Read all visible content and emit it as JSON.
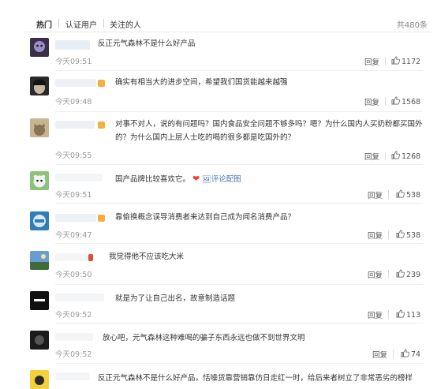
{
  "tabs": [
    {
      "label": "热门",
      "active": true
    },
    {
      "label": "认证用户",
      "active": false
    },
    {
      "label": "关注的人",
      "active": false
    }
  ],
  "total_label": "共480条",
  "comments": [
    {
      "text": "反正元气森林不是什么好产品",
      "time": "今天09:51",
      "reply": "回复",
      "likes": "1172"
    },
    {
      "text": "确实有相当大的进步空间，希望我们国货能越来越强",
      "time": "今天09:48",
      "reply": "回复",
      "likes": "1568"
    },
    {
      "text": "对事不对人，说的有问题吗？国内食品安全问题不够多吗？嗯？为什么国内人买奶粉都买国外的？为什么国内上层人士吃的喝的很多都是吃国外的？",
      "time": "今天09:55",
      "reply": "回复",
      "likes": "1268"
    },
    {
      "text": "国产品牌比较喜欢它。",
      "emoji": "❤",
      "link": "评论配图",
      "time": "今天09:51",
      "reply": "回复",
      "likes": "538"
    },
    {
      "text": "靠偷换概念误导消费者来达到自己成为闻名消费产品？",
      "time": "今天09:47",
      "reply": "回复",
      "likes": "538"
    },
    {
      "text": "我觉得他不应该吃大米",
      "time": "今天09:50",
      "reply": "回复",
      "likes": "239"
    },
    {
      "text": "就是为了让自己出名，故意制造话题",
      "time": "今天09:52",
      "reply": "回复",
      "likes": "113"
    },
    {
      "text": "放心吧，元气森林这种难喝的骗子东西永远也做不到世界文明",
      "time": "今天09:52",
      "reply": "回复",
      "likes": "74"
    },
    {
      "text": "反正元气森林不是什么好产品，恬噪货靠营销靠仿日走红一时，给后来者树立了非常恶劣的榜样",
      "time": "",
      "reply": "",
      "likes": ""
    }
  ]
}
